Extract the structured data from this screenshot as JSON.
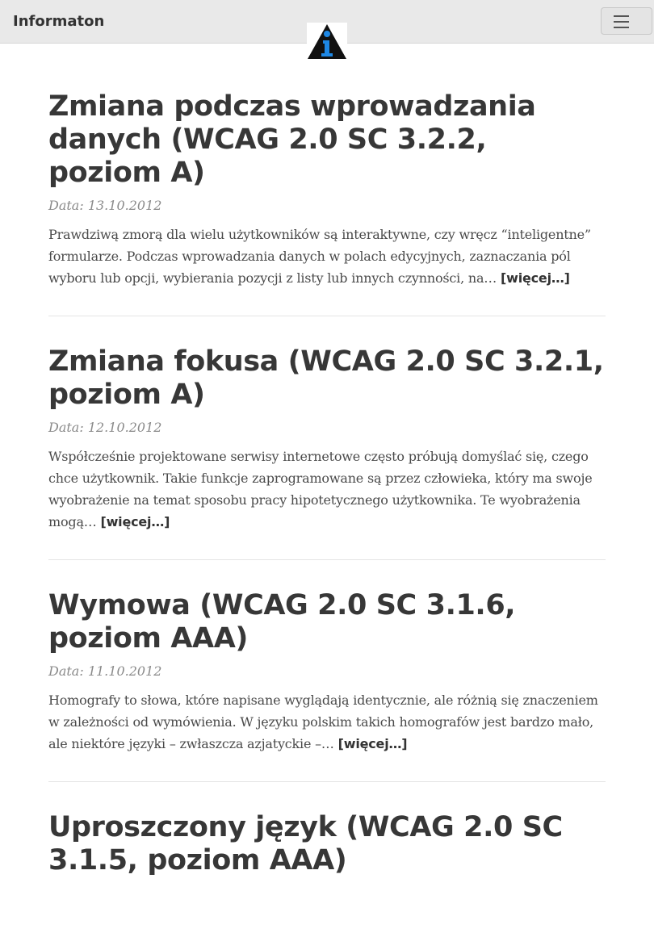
{
  "navbar": {
    "brand": "Informaton",
    "logo_icon": "info-triangle-icon",
    "menu_icon": "hamburger-menu-icon"
  },
  "posts": [
    {
      "title": "Zmiana podczas wprowadzania danych (WCAG 2.0 SC 3.2.2, poziom A)",
      "date": "Data: 13.10.2012",
      "excerpt": "Prawdziwą zmorą dla wielu użytkowników są interaktywne, czy wręcz “inteligentne” formularze. Podczas wprowadzania danych w polach edycyjnych, zaznaczania pól wyboru lub opcji, wybierania pozycji z listy lub innych czynności, na…",
      "more": "[więcej…]"
    },
    {
      "title": "Zmiana fokusa (WCAG 2.0 SC 3.2.1, poziom A)",
      "date": "Data: 12.10.2012",
      "excerpt": "Współcześnie projektowane serwisy internetowe często próbują domyślać się, czego chce użytkownik. Takie funkcje zaprogramowane są przez człowieka, który ma swoje wyobrażenie na temat sposobu pracy hipotetycznego użytkownika. Te wyobrażenia mogą…",
      "more": "[więcej…]"
    },
    {
      "title": "Wymowa (WCAG 2.0 SC 3.1.6, poziom AAA)",
      "date": "Data: 11.10.2012",
      "excerpt": "Homografy to słowa, które napisane wyglądają identycznie, ale różnią się znaczeniem w zależności od wymówienia. W języku polskim takich homografów jest bardzo mało, ale niektóre języki – zwłaszcza azjatyckie –…",
      "more": "[więcej…]"
    },
    {
      "title": "Uproszczony język (WCAG 2.0 SC 3.1.5, poziom AAA)"
    }
  ]
}
